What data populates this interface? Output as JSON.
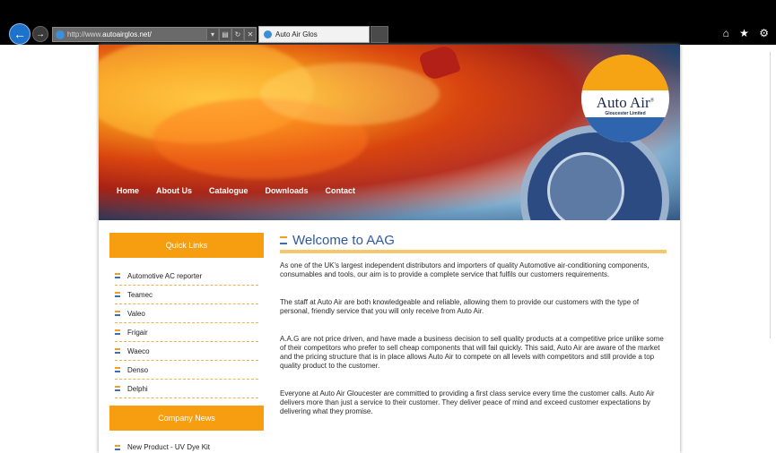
{
  "browser": {
    "url_prefix": "http://www.",
    "url_host": "autoairglos.net/",
    "tab_title": "Auto Air Glos",
    "addr_controls": [
      "▾",
      "▤",
      "↻",
      "✕"
    ],
    "tools": "⌂ ★ ⚙"
  },
  "logo": {
    "name": "Auto Air",
    "reg": "®",
    "subtitle": "Gloucester Limited"
  },
  "nav": [
    "Home",
    "About Us",
    "Catalogue",
    "Downloads",
    "Contact"
  ],
  "sidebar": {
    "quick_links_title": "Quick Links",
    "quick_links": [
      "Automotive AC reporter",
      "Teamec",
      "Valeo",
      "Frigair",
      "Waeco",
      "Denso",
      "Delphi"
    ],
    "news_title": "Company News",
    "news": [
      "New Product - UV Dye Kit"
    ]
  },
  "main": {
    "heading": "Welcome to AAG",
    "paragraphs": [
      "As one of the UK's largest independent distributors and importers of quality Automotive air-conditioning components, consumables and tools, our aim is to provide a complete service that fulfils our customers requirements.",
      "The staff at Auto Air are both knowledgeable and reliable, allowing them to provide our customers with the type of personal, friendly service that you will only receive from Auto Air.",
      "A.A.G are not price driven, and have made a business decision to sell quality products at a competitive price unlike some of their competitors who prefer to sell cheap components that will fail quickly. This said, Auto Air are aware of the market and the pricing structure that is in place allows Auto Air to compete on all levels with competitors and still provide a top quality product to the customer.",
      "Everyone at Auto Air Gloucester are committed to providing a first class service every time the customer calls. Auto Air delivers more than just a service to their customer. They deliver peace of mind and exceed customer expectations by delivering what they promise."
    ]
  }
}
